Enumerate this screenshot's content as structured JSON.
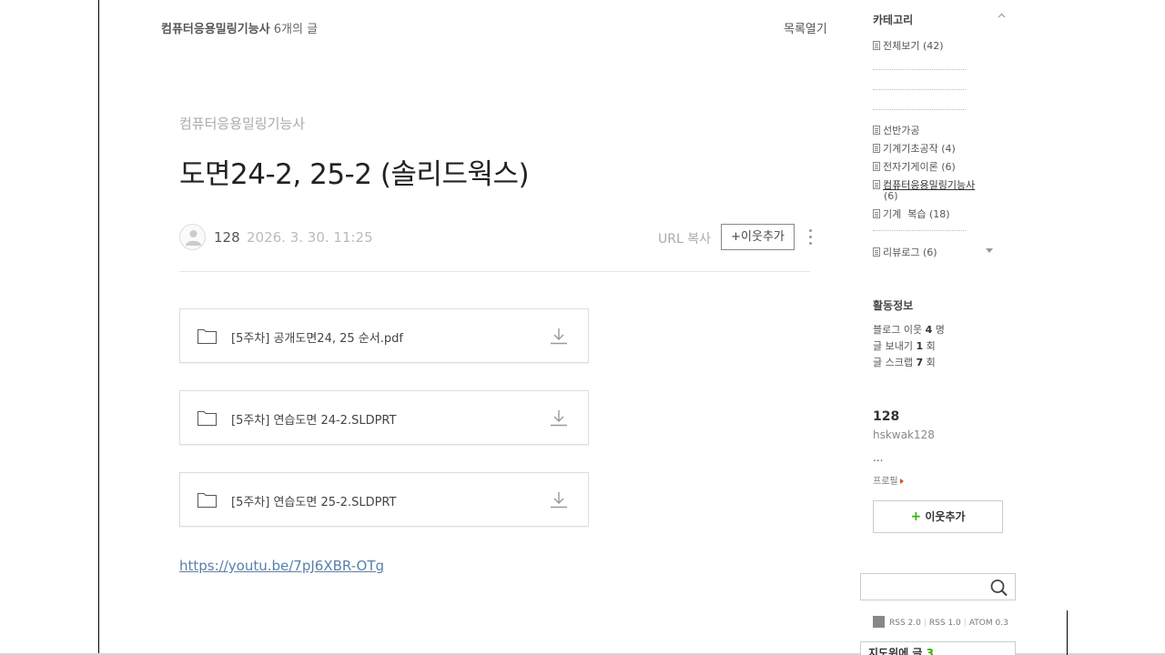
{
  "header": {
    "category": "컴퓨터응용밀링기능사",
    "count_label": "6개의 글",
    "list_open": "목록열기"
  },
  "post": {
    "category": "컴퓨터응용밀링기능사",
    "title": "도면24-2, 25-2 (솔리드웍스)",
    "author": "128",
    "date": "2026. 3. 30. 11:25",
    "url_copy": "URL 복사",
    "add_neighbor": "+이웃추가",
    "files": [
      {
        "name": "[5주차] 공개도면24, 25 순서.pdf"
      },
      {
        "name": "[5주차] 연습도면 24-2.SLDPRT"
      },
      {
        "name": "[5주차] 연습도면 25-2.SLDPRT"
      }
    ],
    "link": "https://youtu.be/7pJ6XBR-OTg"
  },
  "sidebar": {
    "category_title": "카테고리",
    "categories": [
      {
        "label": "전체보기",
        "count": "(42)"
      },
      {
        "label": "선반가공",
        "count": ""
      },
      {
        "label": "기계기초공작",
        "count": "(4)"
      },
      {
        "label": "전자기게이론",
        "count": "(6)"
      },
      {
        "label": "컴퓨터응용밀링기능사",
        "count": "(6)"
      },
      {
        "label": "기계  복습",
        "count": "(18)"
      },
      {
        "label": "리뷰로그",
        "count": "(6)"
      }
    ],
    "activity_title": "활동정보",
    "activity": [
      {
        "label": "블로그 이웃",
        "value": "4",
        "unit": "명"
      },
      {
        "label": "글 보내기",
        "value": "1",
        "unit": "회"
      },
      {
        "label": "글 스크랩",
        "value": "7",
        "unit": "회"
      }
    ],
    "profile": {
      "name": "128",
      "id": "hskwak128",
      "intro": "...",
      "profile_link": "프로필",
      "add_neighbor_plus": "+",
      "add_neighbor": "이웃추가"
    },
    "search": {
      "value": "",
      "placeholder": ""
    },
    "rss": [
      "RSS 2.0",
      "RSS 1.0",
      "ATOM 0.3"
    ],
    "bottom_label": "지도위에 글",
    "bottom_count": "3",
    "accent_color": "#2db400"
  }
}
